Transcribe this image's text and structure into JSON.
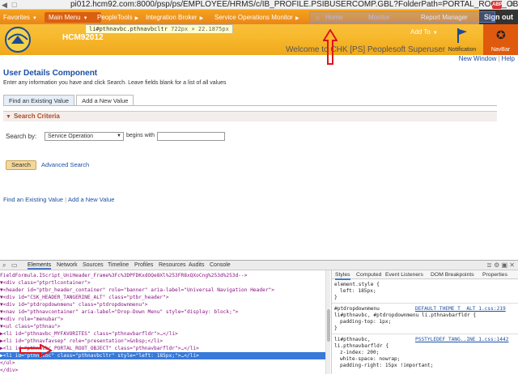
{
  "browser": {
    "url": "pi012.hcm92.com:8000/psp/ps/EMPLOYEE/HRMS/c/IB_PROFILE.PSIBUSERCOMP.GBL?FolderPath=PORTAL_ROOT_OBJE",
    "back_icon": "back-arrow-icon",
    "ext_badge": "ABP"
  },
  "ps_header": {
    "nav_favorites": "Favorites",
    "nav_main_menu": "Main Menu",
    "nav_tools": "PeopleTools",
    "nav_broker": "Integration Broker",
    "nav_ops": "Service Operations Monitor",
    "nav_mon": "Monitor",
    "nav_home": "Home",
    "nav_report": "Report Manager",
    "hcm_label": "HCM92012",
    "add_to": "Add To",
    "welcome": "Welcome to CHK [PS] Peoplesoft Superuser",
    "notification": "Notification",
    "sign_out": "Sign out",
    "navbar": "NavBar",
    "brand_color": "#f7b92d",
    "navbar_color": "#e05a0d"
  },
  "tooltip": {
    "selector": "li#pthnavbc.pthnavbcltr",
    "size": "722px × 22.1875px"
  },
  "page_links": {
    "new_window": "New Window",
    "help": "Help"
  },
  "content": {
    "title": "User Details Component",
    "instructions": "Enter any information you have and click Search. Leave fields blank for a list of all values",
    "tab_find": "Find an Existing Value",
    "tab_add": "Add a New Value",
    "criteria_label": "Search Criteria",
    "search_by_label": "Search by:",
    "search_by_value": "Service Operation",
    "begins_with": "begins with",
    "search_button": "Search",
    "advanced_search": "Advanced Search",
    "bottom_find": "Find an Existing Value",
    "bottom_add": "Add a New Value"
  },
  "devtools": {
    "tabs": [
      "Elements",
      "Network",
      "Sources",
      "Timeline",
      "Profiles",
      "Resources",
      "Audits",
      "Console"
    ],
    "style_tabs": [
      "Styles",
      "Computed",
      "Event Listeners",
      "DOM Breakpoints",
      "Properties"
    ],
    "dom_lines": [
      {
        "text": "FieldFormula.IScript_UniHeader_Frame%3Fc%3DPFDKxdOQe8Xl%253FR8xQXoCng%253d%253d-->",
        "sel": false
      },
      {
        "text": "▼<div class=\"ptprtlcontainer\">",
        "sel": false
      },
      {
        "text": "  ▼<header id=\"ptbr_header_container\" role=\"banner\" aria-label=\"Universal Navigation Header\">",
        "sel": false
      },
      {
        "text": "    ▼<div id=\"CSK_HEADER_TANGERINE_ALT\" class=\"ptbr_header\">",
        "sel": false
      },
      {
        "text": "      ▼<div id=\"ptdropdownmenu\" class=\"ptdropdownmenu\">",
        "sel": false
      },
      {
        "text": "        ▼<nav id=\"pthnavcontainer\" aria-label=\"Drop-Down Menu\" style=\"display: block;\">",
        "sel": false
      },
      {
        "text": "          ▼<div role=\"menubar\">",
        "sel": false
      },
      {
        "text": "            ▼<ul class=\"pthnau\">",
        "sel": false
      },
      {
        "text": "              ▶<li id=\"pthnavbc_MYFAVORITES\" class=\"pthnavbarfldr\">…</li>",
        "sel": false
      },
      {
        "text": "              ▶<li id=\"pthnavfavsep\" role=\"presentation\">&nbsp;</li>",
        "sel": false
      },
      {
        "text": "              ▶<li id=\"pthnavbc_PORTAL_ROOT_OBJECT\" class=\"pthnavbarfldr\">…</li>",
        "sel": false
      },
      {
        "text": "              ▶<li id=\"pthnavbc\" class=\"pthnavbcltr\" style=\"left: 185px;\">…</li>",
        "sel": true
      },
      {
        "text": "              </ul>",
        "sel": false
      },
      {
        "text": "            </div>",
        "sel": false
      }
    ],
    "style_element": "element.style {",
    "style_left": "left: 185px;",
    "rule1_sel": "#ptdropdownmenu",
    "rule1_sel2": "li#pthnavbc, #ptdropdownmenu li.pthnavbarfldr {",
    "rule1_src": "DEFAULT_THEME_T__ALT_1.css:219",
    "rule1_prop": "padding-top: 1px;",
    "rule2_sel": "li#pthnavbc,",
    "rule2_sel2": "li.pthnavbarfldr {",
    "rule2_src": "PSSTYLEDEF_TANG..INE_1.css:1442",
    "rule2_p1": "z-index: 200;",
    "rule2_p2": "white-space: nowrap;",
    "rule2_p3": "padding-right: 15px !important;"
  }
}
